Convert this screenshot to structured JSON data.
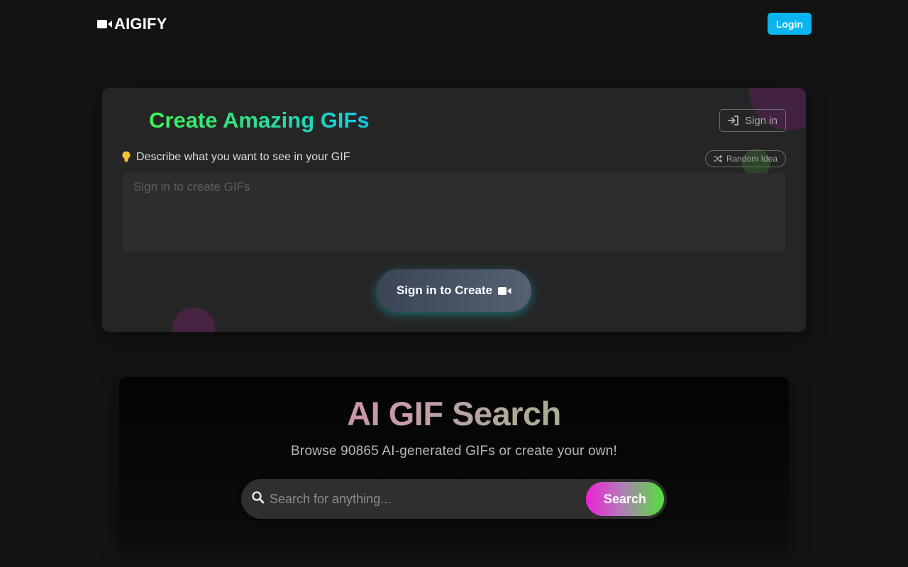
{
  "header": {
    "logo_text": "AIGIFY",
    "logo_icon": "video-camera-icon",
    "login_label": "Login",
    "accent_color": "#0ab4ee"
  },
  "create": {
    "title": "Create Amazing GIFs",
    "signin_label": "Sign in",
    "signin_icon": "sign-in-icon",
    "prompt_label": "Describe what you want to see in your GIF",
    "prompt_icon": "lightbulb-icon",
    "random_label": "Random Idea",
    "random_icon": "shuffle-icon",
    "prompt_placeholder": "Sign in to create GIFs",
    "prompt_value": "",
    "create_label": "Sign in to Create",
    "create_icon": "video-camera-icon"
  },
  "search": {
    "title": "AI GIF Search",
    "subtitle": "Browse 90865 AI-generated GIFs or create your own!",
    "placeholder": "Search for anything...",
    "value": "",
    "search_icon": "search-icon",
    "button_label": "Search"
  }
}
